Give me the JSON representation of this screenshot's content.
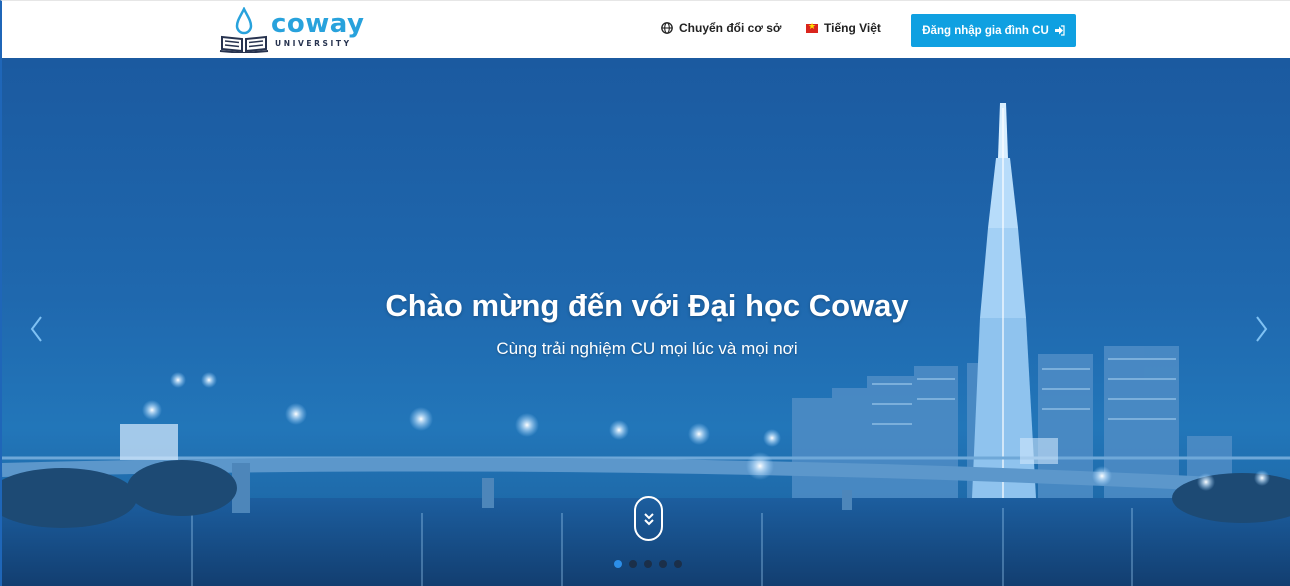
{
  "header": {
    "logo": {
      "word": "coway",
      "sub": "UNIVERSITY"
    },
    "campus_switch": "Chuyển đổi cơ sở",
    "language": "Tiếng Việt",
    "login_button": "Đăng nhập gia đình CU"
  },
  "hero": {
    "title": "Chào mừng đến với Đại học Coway",
    "subtitle": "Cùng trải nghiệm CU mọi lúc và mọi nơi",
    "slides": 5,
    "active_slide": 1
  },
  "colors": {
    "brand": "#28a2dc",
    "button": "#0fa0e1",
    "hero": "#1f68ae"
  },
  "icons": [
    "globe-icon",
    "vietnam-flag-icon",
    "sign-in-icon",
    "chevron-left-icon",
    "chevron-right-icon",
    "double-chevron-down-icon"
  ]
}
